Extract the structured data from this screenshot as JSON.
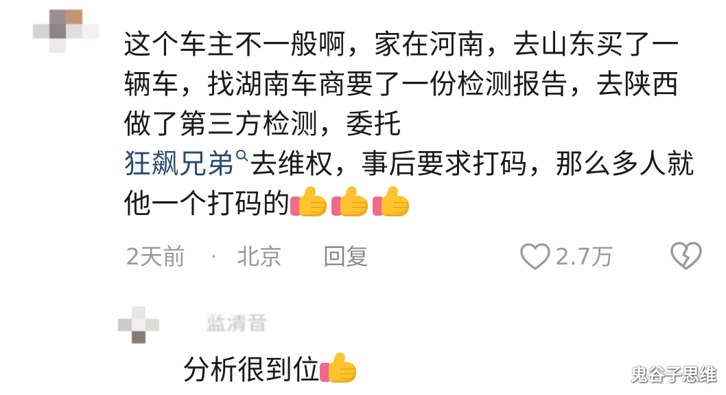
{
  "comment": {
    "text_before_mention": "这个车主不一般啊，家在河南，去山东买了一辆车，找湖南车商要了一份检测报告，去陕西做了第三方检测，委托",
    "mention": "狂飙兄弟",
    "text_after_mention": "去维权，事后要求打码，那么多人就他一个打码的",
    "time": "2天前",
    "separator": "·",
    "location": "北京",
    "reply_label": "回复",
    "like_count": "2.7万"
  },
  "reply": {
    "username": "蓝清音",
    "text": "分析很到位"
  },
  "watermark": "鬼谷子思维",
  "icons": {
    "search": "search-icon",
    "thumbs_up": "thumbs-up-emoji",
    "like": "heart-outline-icon",
    "dislike": "broken-heart-icon"
  },
  "colors": {
    "mention": "#2b4b6f",
    "meta_gray": "#9a9a9a",
    "thumb_yellow": "#ffc32e",
    "thumb_cuff": "#f06a8b"
  },
  "emoji_counts": {
    "comment_thumbs": 3,
    "reply_thumbs": 1
  }
}
